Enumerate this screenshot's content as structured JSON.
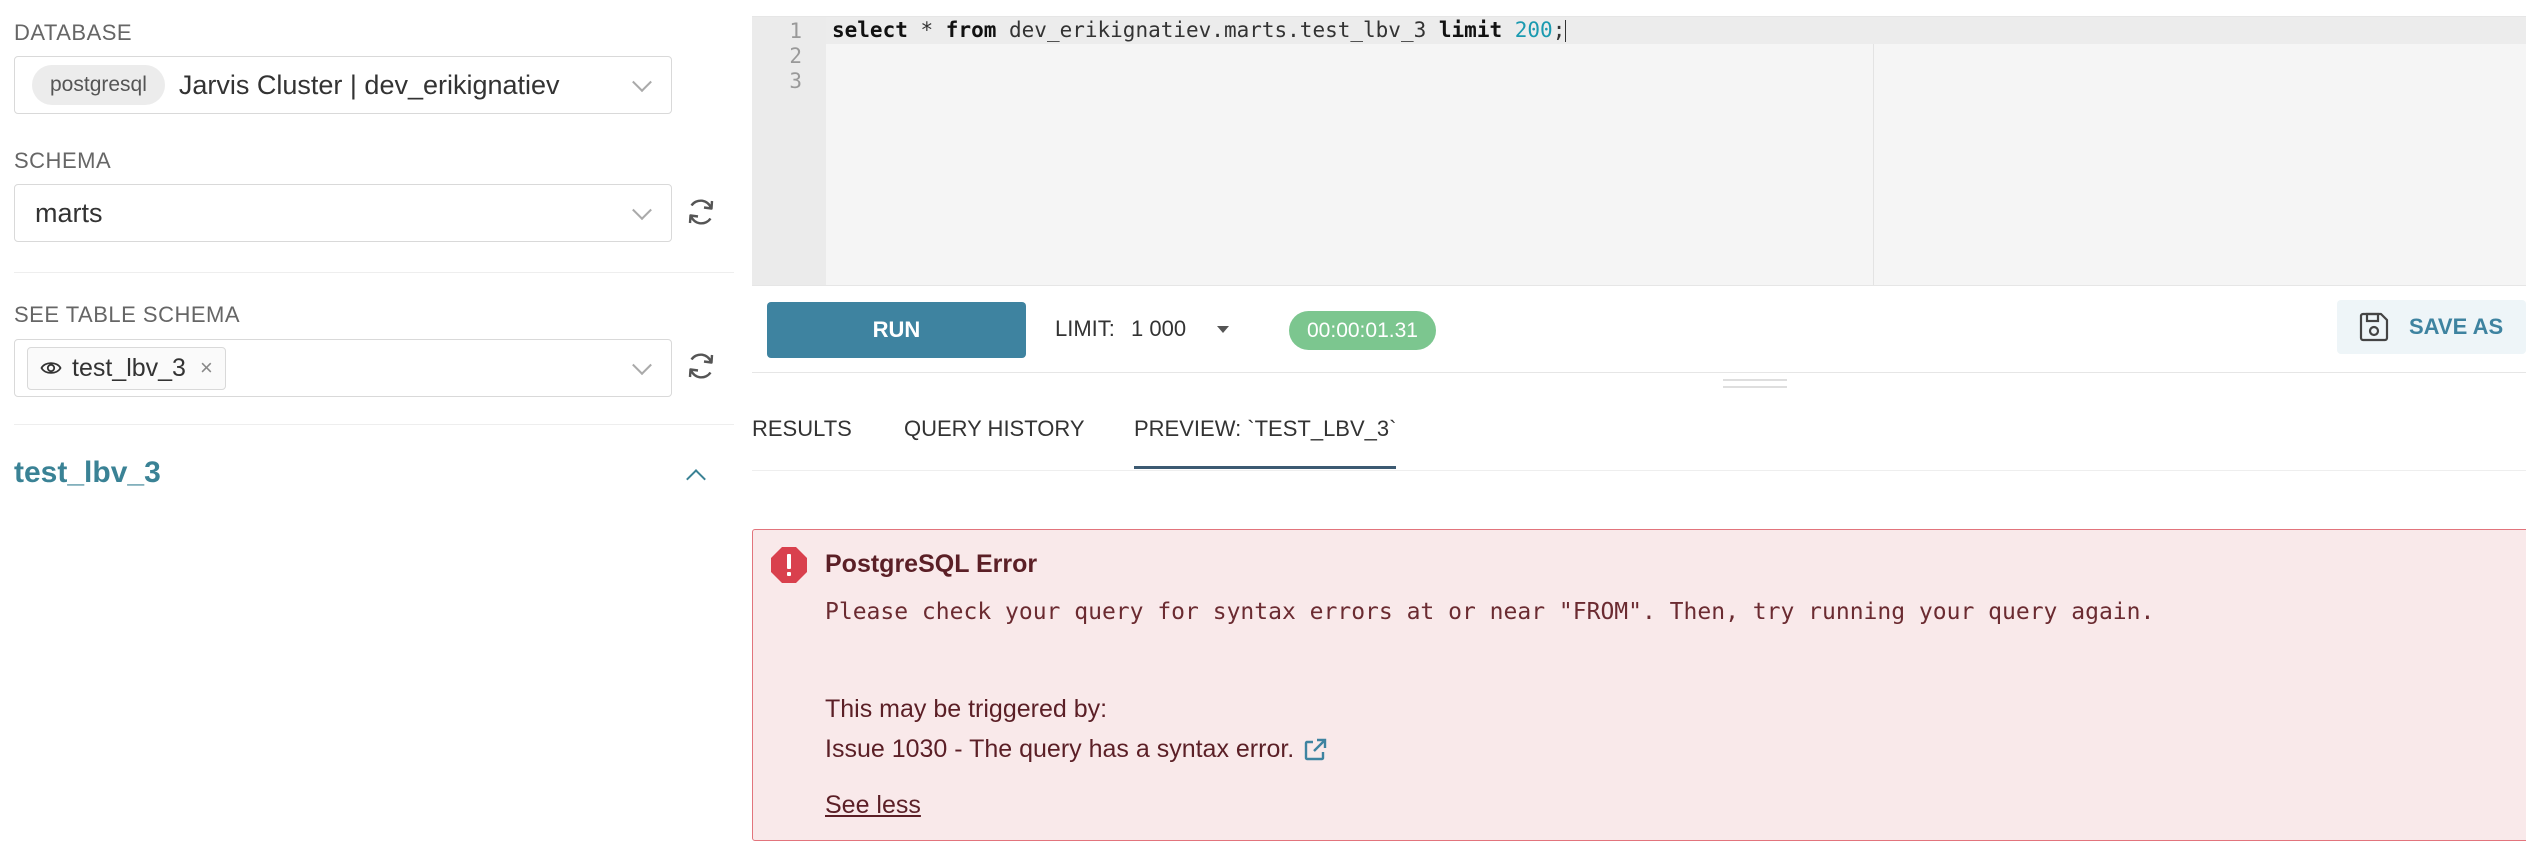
{
  "sidebar": {
    "database": {
      "label": "DATABASE",
      "engine_pill": "postgresql",
      "value": "Jarvis Cluster | dev_erikignatiev"
    },
    "schema": {
      "label": "SCHEMA",
      "value": "marts"
    },
    "table_schema": {
      "label": "SEE TABLE SCHEMA",
      "tag": "test_lbv_3",
      "remove_symbol": "×"
    },
    "table_title": "test_lbv_3"
  },
  "editor": {
    "line_numbers": [
      "1",
      "2",
      "3"
    ],
    "query": {
      "kw_select": "select",
      "star": " * ",
      "kw_from": "from",
      "table": " dev_erikignatiev.marts.test_lbv_3 ",
      "kw_limit": "limit",
      "space": " ",
      "limit_num": "200",
      "semicolon": ";"
    }
  },
  "toolbar": {
    "run_label": "RUN",
    "limit_label": "LIMIT:",
    "limit_value": "1 000",
    "timer": "00:00:01.31",
    "save_as_label": "SAVE AS"
  },
  "tabs": [
    {
      "label": "RESULTS",
      "active": false
    },
    {
      "label": "QUERY HISTORY",
      "active": false
    },
    {
      "label": "PREVIEW: `TEST_LBV_3`",
      "active": true
    }
  ],
  "error": {
    "title": "PostgreSQL Error",
    "message": "Please check your query for syntax errors at or near \"FROM\". Then, try running your query again.",
    "triggered_by": "This may be triggered by:",
    "issue": "Issue 1030 - The query has a syntax error.",
    "see_less": "See less"
  },
  "colors": {
    "accent": "#3e83a0",
    "timer_green": "#7cc68f",
    "error_bg": "#f9e9ea",
    "error_border": "#e2747c",
    "error_icon": "#d9404d"
  }
}
